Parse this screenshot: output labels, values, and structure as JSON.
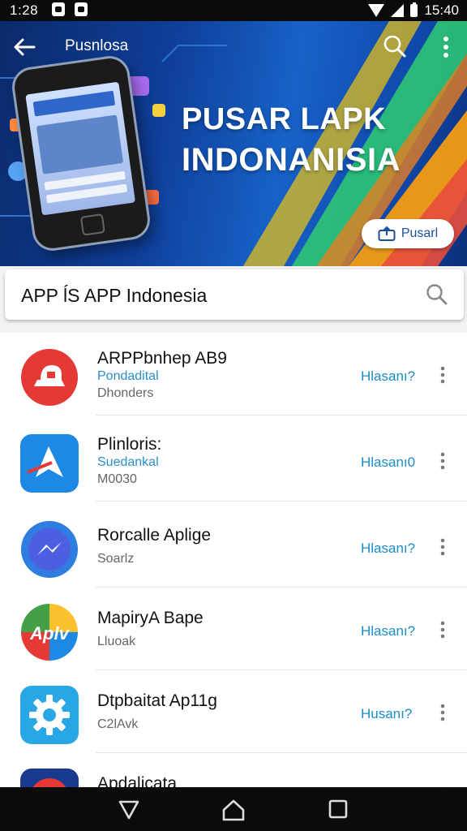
{
  "status": {
    "time": "1:28",
    "clock_right": "15:40"
  },
  "appbar": {
    "title": "Pusnlosa"
  },
  "hero": {
    "title_line1": "PUSAR LAPK",
    "title_line2": "INDONANISIA",
    "button_label": "Pusarl"
  },
  "search": {
    "value": "APP ĺS APP Indonesia"
  },
  "apps": [
    {
      "name": "ARPPbnhep AB9",
      "category": "Pondadital",
      "size": "Dhonders",
      "action": "Hlasanı?",
      "icon": "red-mailbox-icon",
      "color": "#e53935"
    },
    {
      "name": "Plinloris:",
      "category": "Suedankal",
      "size": "M0030",
      "action": "Hlasanı0",
      "icon": "paper-plane-icon",
      "color": "#1e88e5"
    },
    {
      "name": "Rorcalle Aplige",
      "category": "",
      "size": "Soarlz",
      "action": "Hlasanı?",
      "icon": "messenger-icon",
      "color": "#3f51d8"
    },
    {
      "name": "MapiryA Bape",
      "category": "",
      "size": "Lluoak",
      "action": "Hlasanı?",
      "icon": "aplv-multicolor-icon",
      "color": "#43a047"
    },
    {
      "name": "Dtpbaitat Ap11g",
      "category": "",
      "size": "C2lAvk",
      "action": "Husanı?",
      "icon": "gear-icon",
      "color": "#29a6e6"
    },
    {
      "name": "Apdalicata",
      "category": "",
      "size": "",
      "action": "",
      "icon": "red-camera-icon",
      "color": "#e53935"
    }
  ],
  "colors": {
    "accent": "#1a8cc7",
    "hero": "#1762c7"
  }
}
